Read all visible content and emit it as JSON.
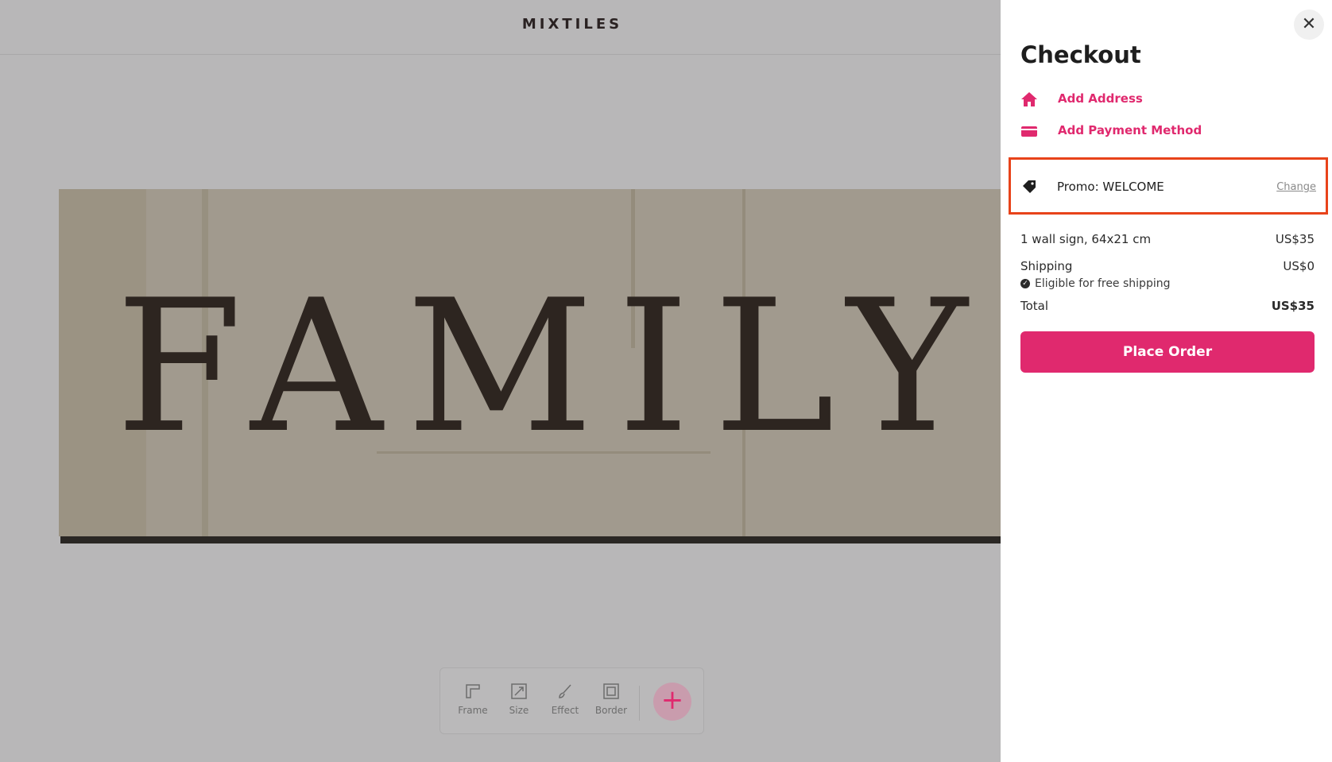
{
  "header": {
    "logo": "MIXTILES"
  },
  "canvas": {
    "sign_text": "FAMILY"
  },
  "toolbar": {
    "tools": [
      {
        "label": "Frame",
        "icon": "frame-icon"
      },
      {
        "label": "Size",
        "icon": "resize-icon"
      },
      {
        "label": "Effect",
        "icon": "brush-icon"
      },
      {
        "label": "Border",
        "icon": "border-icon"
      }
    ],
    "add_label": "+"
  },
  "checkout": {
    "title": "Checkout",
    "close_label": "✕",
    "add_address": "Add Address",
    "add_payment": "Add Payment Method",
    "promo": {
      "label": "Promo: WELCOME",
      "change": "Change"
    },
    "item": {
      "label": "1 wall sign, 64x21 cm",
      "price": "US$35"
    },
    "shipping": {
      "label": "Shipping",
      "price": "US$0",
      "note": "Eligible for free shipping"
    },
    "total": {
      "label": "Total",
      "price": "US$35"
    },
    "place_order": "Place Order"
  },
  "colors": {
    "accent": "#e0296e",
    "highlight": "#e8431a"
  }
}
